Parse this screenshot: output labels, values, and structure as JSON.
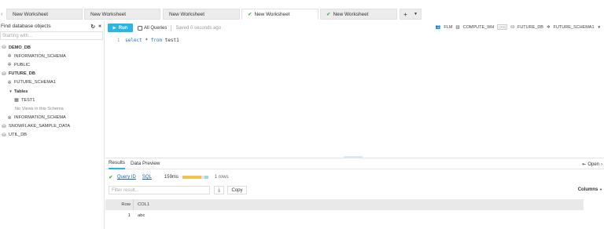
{
  "tabs": [
    {
      "label": "New Worksheet",
      "status": "none"
    },
    {
      "label": "New Worksheet",
      "status": "none"
    },
    {
      "label": "New Worksheet",
      "status": "none"
    },
    {
      "label": "New Worksheet",
      "status": "success"
    },
    {
      "label": "New Worksheet",
      "status": "success"
    }
  ],
  "active_tab_index": 3,
  "tab_scroll_left": "‹",
  "add_tab": "+",
  "sidebar": {
    "title": "Find database objects",
    "search_placeholder": "Starting with...",
    "tree": [
      {
        "label": "DEMO_DB",
        "icon": "database-icon",
        "bold": true
      },
      {
        "label": "INFORMATION_SCHEMA",
        "icon": "schema-icon"
      },
      {
        "label": "PUBLIC",
        "icon": "schema-icon"
      },
      {
        "label": "FUTURE_DB",
        "icon": "database-icon",
        "bold": true
      },
      {
        "label": "FUTURE_SCHEMA1",
        "icon": "schema-icon"
      },
      {
        "label": "Tables",
        "icon": "caret-down-icon",
        "bold": true
      },
      {
        "label": "TEST1",
        "icon": "table-icon"
      },
      {
        "label": "No Views in this Schema",
        "icon": "none",
        "muted": true
      },
      {
        "label": "INFORMATION_SCHEMA",
        "icon": "schema-icon"
      },
      {
        "label": "SNOWFLAKE_SAMPLE_DATA",
        "icon": "database-icon"
      },
      {
        "label": "UTIL_DB",
        "icon": "database-icon"
      }
    ]
  },
  "toolbar": {
    "run_label": "Run",
    "all_queries_label": "All Queries",
    "saved_text": "Saved 0 seconds ago"
  },
  "context": {
    "role": "FLM",
    "warehouse": "COMPUTE_WH",
    "warehouse_size": "(XS)",
    "database": "FUTURE_DB",
    "schema": "FUTURE_SCHEMA1"
  },
  "editor": {
    "line_number": "1",
    "kw_select": "select",
    "star": "*",
    "kw_from": "from",
    "table": "test1"
  },
  "results": {
    "tab_results": "Results",
    "tab_preview": "Data Preview",
    "open_label": "Open",
    "query_id_label": "Query ID",
    "sql_label": "SQL",
    "duration": "159ms",
    "duration_fill": 0.72,
    "rows_text": "1 rows",
    "filter_placeholder": "Filter result...",
    "copy_label": "Copy",
    "columns_label": "Columns",
    "grid_headers": [
      "Row",
      "COL1"
    ],
    "grid_rows": [
      [
        "1",
        "abc"
      ]
    ]
  },
  "colors": {
    "run_button": "#29b5e8",
    "success": "#2fa34a",
    "duration_bar": "#f2c14e"
  }
}
